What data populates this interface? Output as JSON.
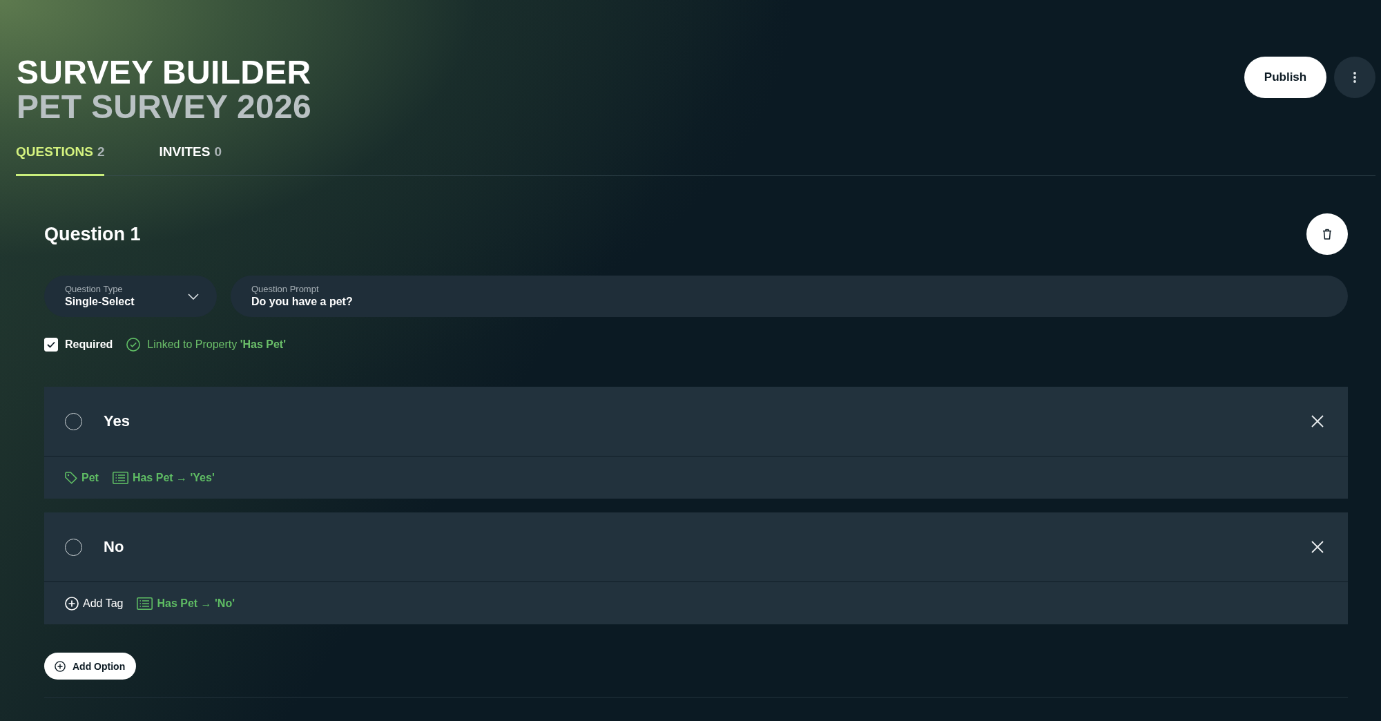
{
  "header": {
    "title": "SURVEY BUILDER",
    "subtitle": "PET SURVEY 2026",
    "publish_button": "Publish"
  },
  "tabs": [
    {
      "label": "QUESTIONS",
      "count": "2",
      "selected": true
    },
    {
      "label": "INVITES",
      "count": "0",
      "selected": false
    }
  ],
  "question": {
    "title": "Question 1",
    "type_field": {
      "label": "Question Type",
      "value": "Single-Select"
    },
    "prompt_field": {
      "label": "Question Prompt",
      "value": "Do you have a pet?"
    },
    "required": {
      "label": "Required",
      "checked": true
    },
    "link_status": "Linked to Property **'Has Pet'**",
    "options": [
      {
        "label": "Yes",
        "selected": false,
        "tags": [
          {
            "kind": "tag",
            "label": "Pet"
          },
          {
            "kind": "mapping",
            "label": "**Has Pet** → **'Yes'**"
          }
        ]
      },
      {
        "label": "No",
        "selected": false,
        "tags": [
          {
            "kind": "add",
            "label": "Add Tag"
          },
          {
            "kind": "mapping",
            "label": "**Has Pet** → **'No'**"
          }
        ]
      }
    ],
    "add_option_button": "Add Option"
  }
}
